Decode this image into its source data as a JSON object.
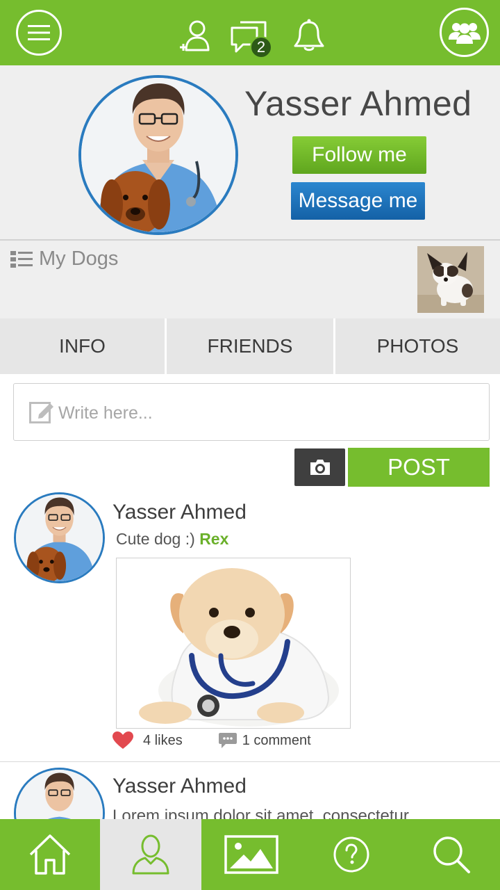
{
  "header": {
    "notification_count": "2"
  },
  "profile": {
    "name": "Yasser Ahmed",
    "follow_label": "Follow me",
    "message_label": "Message me"
  },
  "my_dogs": {
    "label": "My Dogs"
  },
  "tabs": [
    {
      "label": "INFO"
    },
    {
      "label": "FRIENDS"
    },
    {
      "label": "PHOTOS"
    }
  ],
  "composer": {
    "placeholder": "Write here...",
    "post_label": "POST"
  },
  "posts": [
    {
      "author": "Yasser Ahmed",
      "text": "Cute dog :) ",
      "tag": "Rex",
      "likes": "4 likes",
      "comments": "1 comment"
    },
    {
      "author": "Yasser Ahmed",
      "text": "Lorem ipsum dolor sit amet, consectetur"
    }
  ],
  "colors": {
    "accent": "#76bd2e",
    "follow": "#6cb52a",
    "message": "#1b6fb8",
    "avatar_ring": "#2a7bbf"
  },
  "icons": {
    "top": [
      "menu-icon",
      "add-user-icon",
      "chat-icon",
      "bell-icon",
      "group-icon"
    ],
    "bottom": [
      "home-icon",
      "profile-icon",
      "gallery-icon",
      "help-icon",
      "search-icon"
    ]
  }
}
